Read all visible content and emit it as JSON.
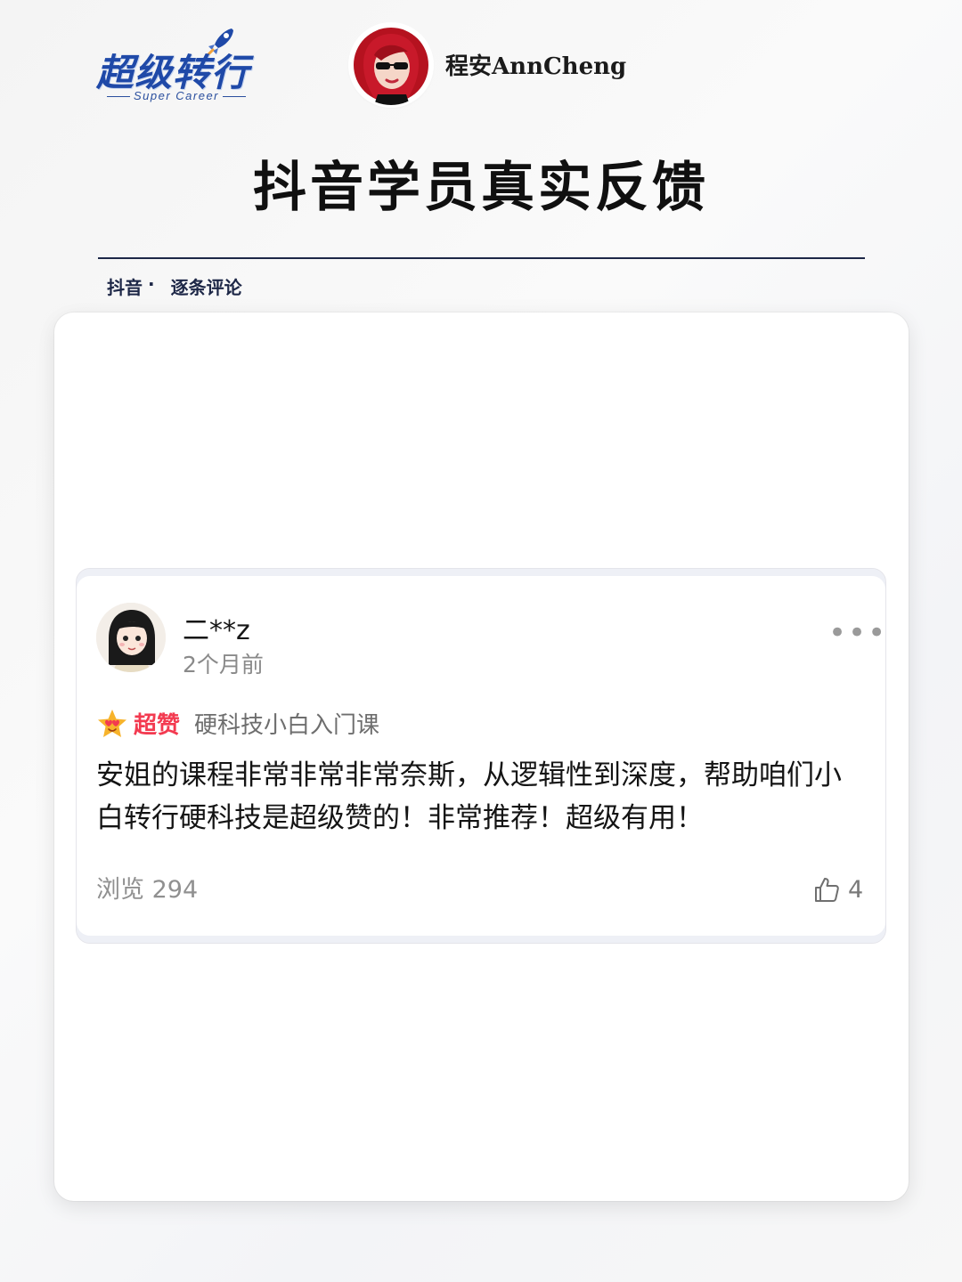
{
  "header": {
    "brand_cn": "超级转行",
    "brand_en": "Super Career",
    "author_name": "程安AnnCheng",
    "title": "抖音学员真实反馈"
  },
  "crumb": {
    "platform": "抖音",
    "separator": "·",
    "section": "逐条评论"
  },
  "comment": {
    "username": "二**z",
    "time": "2个月前",
    "badge_label": "超赞",
    "course": "硬科技小白入门课",
    "body": "安姐的课程非常非常非常奈斯，从逻辑性到深度，帮助咱们小白转行硬科技是超级赞的！非常推荐！超级有用！",
    "views": "浏览 294",
    "likes": "4",
    "more": "•••"
  },
  "colors": {
    "brand_blue": "#1f49a8",
    "badge_red": "#f33a50",
    "divider": "#1d2747"
  },
  "icons": [
    "rocket-icon",
    "more-icon",
    "star-heart-eyes-icon",
    "thumbs-up-icon"
  ]
}
